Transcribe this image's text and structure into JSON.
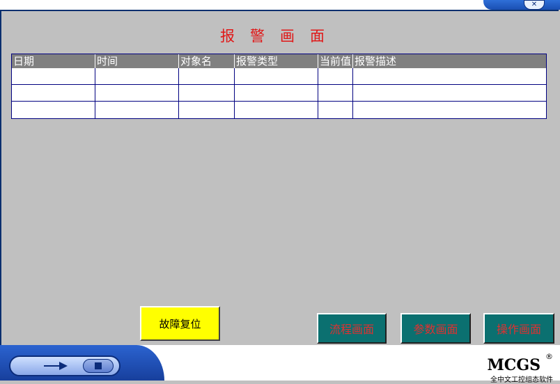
{
  "window": {
    "close_icon": "close-icon"
  },
  "title": "报警画面",
  "table": {
    "columns": [
      "日期",
      "时间",
      "对象名",
      "报警类型",
      "当前值",
      "报警描述"
    ],
    "rows": [
      [
        "",
        "",
        "",
        "",
        "",
        ""
      ],
      [
        "",
        "",
        "",
        "",
        "",
        ""
      ],
      [
        "",
        "",
        "",
        "",
        "",
        ""
      ]
    ]
  },
  "buttons": {
    "reset": "故障复位",
    "flow": "流程画面",
    "params": "参数画面",
    "operate": "操作画面"
  },
  "footer": {
    "play_icon": "play-icon",
    "stop_icon": "stop-icon",
    "logo": "MCGS",
    "logo_reg": "®",
    "logo_sub": "全中文工控组态软件"
  },
  "colors": {
    "title": "#e01818",
    "reset_button_bg": "#ffff00",
    "nav_button_bg": "#0b7070",
    "nav_button_text": "#e03030",
    "table_header_bg": "#808080",
    "chrome_blue": "#1a4fb2"
  }
}
